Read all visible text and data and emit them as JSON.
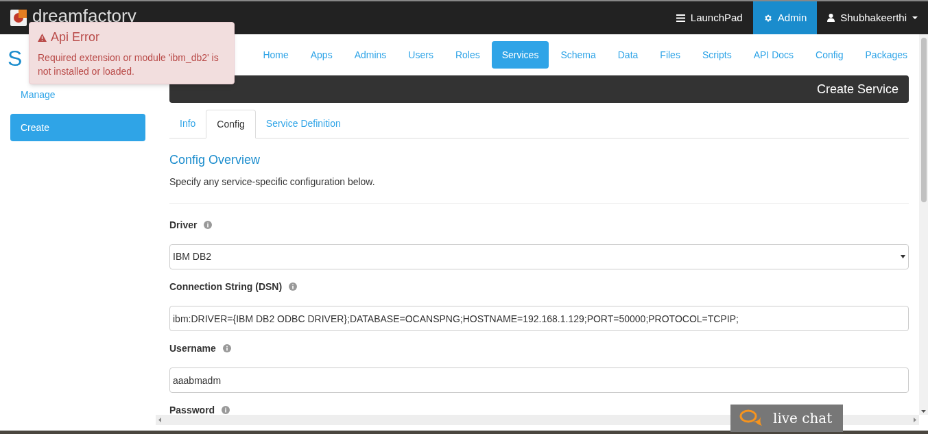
{
  "header": {
    "logo_text": "dreamfactory",
    "items": [
      {
        "kind": "menu",
        "label": "LaunchPad",
        "selected": false
      },
      {
        "kind": "gear",
        "label": "Admin",
        "selected": true
      },
      {
        "kind": "user",
        "label": "Shubhakeerthi",
        "selected": false
      }
    ]
  },
  "page_heading": "S",
  "nav_tabs": [
    {
      "label": "Home",
      "selected": false
    },
    {
      "label": "Apps",
      "selected": false
    },
    {
      "label": "Admins",
      "selected": false
    },
    {
      "label": "Users",
      "selected": false
    },
    {
      "label": "Roles",
      "selected": false
    },
    {
      "label": "Services",
      "selected": true
    },
    {
      "label": "Schema",
      "selected": false
    },
    {
      "label": "Data",
      "selected": false
    },
    {
      "label": "Files",
      "selected": false
    },
    {
      "label": "Scripts",
      "selected": false
    },
    {
      "label": "API Docs",
      "selected": false
    },
    {
      "label": "Config",
      "selected": false
    },
    {
      "label": "Packages",
      "selected": false
    }
  ],
  "sidebar": {
    "items": [
      {
        "label": "Manage",
        "selected": false
      },
      {
        "label": "Create",
        "selected": true
      }
    ]
  },
  "panel_title": "Create Service",
  "tabs": [
    {
      "label": "Info",
      "selected": false
    },
    {
      "label": "Config",
      "selected": true
    },
    {
      "label": "Service Definition",
      "selected": false
    }
  ],
  "section": {
    "title": "Config Overview",
    "description": "Specify any service-specific configuration below."
  },
  "fields": [
    {
      "kind": "select",
      "label": "Driver",
      "value": "IBM DB2"
    },
    {
      "kind": "text",
      "label": "Connection String (DSN)",
      "value": "ibm:DRIVER={IBM DB2 ODBC DRIVER};DATABASE=OCANSPNG;HOSTNAME=192.168.1.129;PORT=50000;PROTOCOL=TCPIP;"
    },
    {
      "kind": "text",
      "label": "Username",
      "value": "aaabmadm"
    },
    {
      "kind": "label",
      "label": "Password"
    }
  ],
  "toast": {
    "title": "Api Error",
    "message": "Required extension or module 'ibm_db2' is not installed or loaded."
  },
  "live_chat": {
    "label": "live chat"
  }
}
